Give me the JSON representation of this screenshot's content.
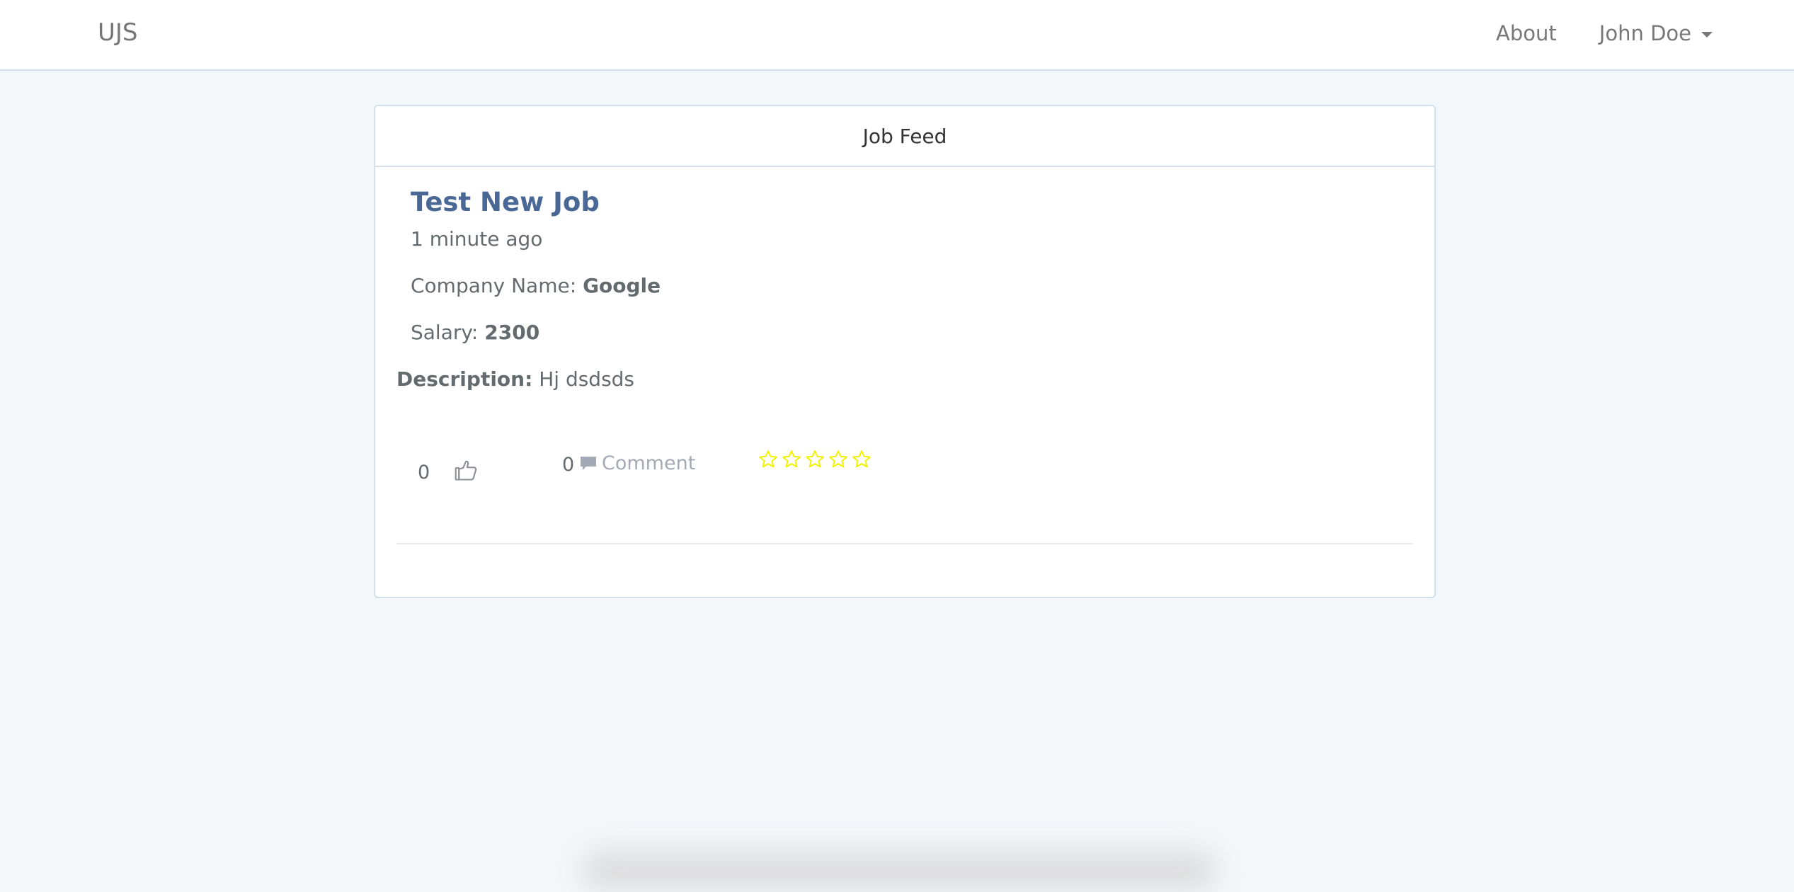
{
  "navbar": {
    "brand": "UJS",
    "about_label": "About",
    "user_label": "John Doe"
  },
  "panel": {
    "heading": "Job Feed"
  },
  "job": {
    "title": "Test New Job",
    "time": "1 minute ago",
    "company_label": "Company Name:",
    "company_value": "Google",
    "salary_label": "Salary:",
    "salary_value": "2300",
    "description_label": "Description:",
    "description_value": "Hj dsdsds",
    "like_count": "0",
    "comment_count": "0",
    "comment_label": "Comment",
    "rating": 0,
    "rating_max": 5
  },
  "colors": {
    "accent": "#4a6896",
    "star": "#f2f200",
    "background": "#f3f7fa"
  },
  "icons": {
    "like": "thumbs-up-icon",
    "comment": "comment-icon",
    "star": "star-outline-icon",
    "caret": "caret-down-icon"
  }
}
